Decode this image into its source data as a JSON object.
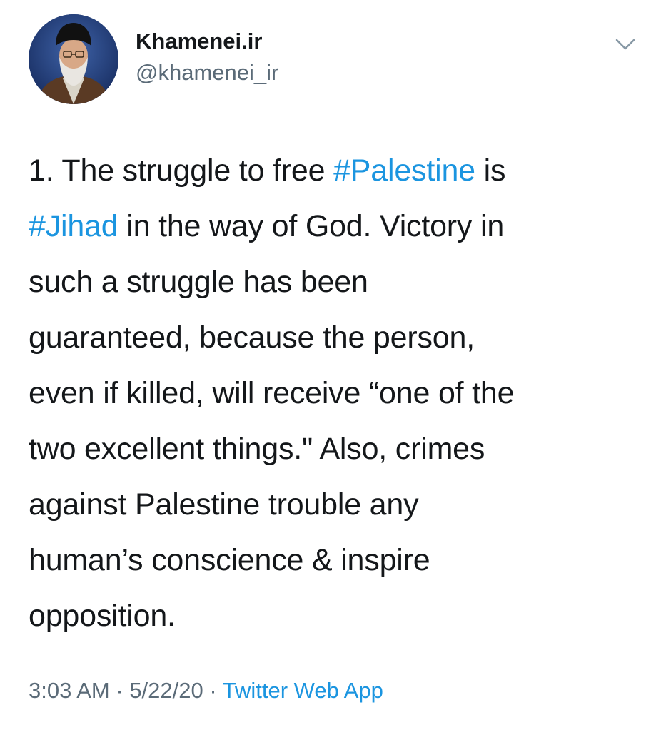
{
  "user": {
    "display_name": "Khamenei.ir",
    "handle": "@khamenei_ir",
    "avatar_icon": "profile-photo"
  },
  "menu": {
    "icon": "chevron-down-icon"
  },
  "tweet": {
    "lines": [
      [
        "1. The struggle to free ",
        "#Palestine",
        " is"
      ],
      [
        "#Jihad",
        " in the way of God. Victory in"
      ],
      [
        "such a struggle has been"
      ],
      [
        "guaranteed, because the person,"
      ],
      [
        "even if killed, will receive “one of the"
      ],
      [
        "two excellent things.\" Also, crimes"
      ],
      [
        "against Palestine trouble any"
      ],
      [
        "human’s conscience & inspire"
      ],
      [
        "opposition."
      ]
    ]
  },
  "meta": {
    "time": "3:03 AM",
    "sep1": " · ",
    "date": "5/22/20",
    "sep2": " · ",
    "source": "Twitter Web App"
  },
  "colors": {
    "link": "#1b95e0",
    "secondary_text": "#5b6b78",
    "primary_text": "#14171a"
  }
}
